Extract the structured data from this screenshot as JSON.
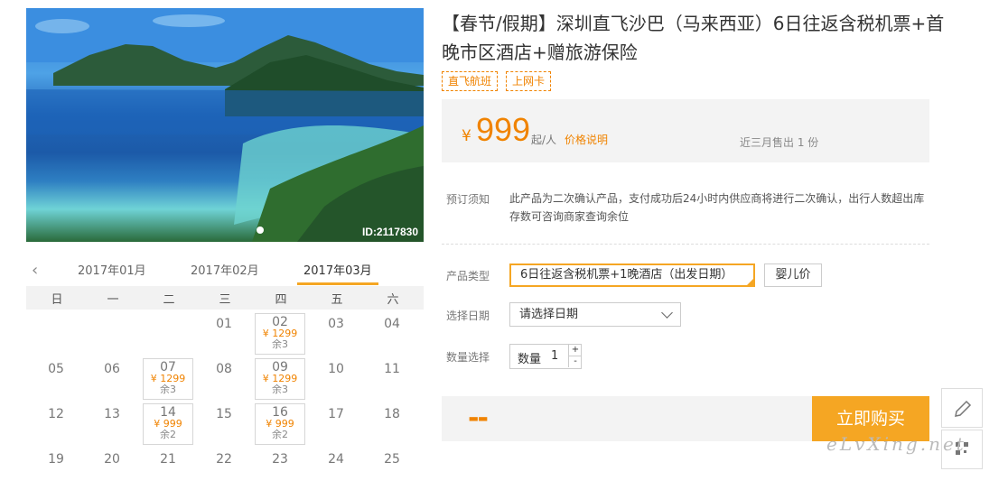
{
  "product": {
    "title": "【春节/假期】深圳直飞沙巴（马来西亚）6日往返含税机票+首晚市区酒店+赠旅游保险",
    "tags": [
      "直飞航班",
      "上网卡"
    ],
    "image_id": "ID:2117830"
  },
  "price": {
    "currency": "¥",
    "amount": "999",
    "per": "起/人",
    "explain_link": "价格说明",
    "sold": "近三月售出 1 份"
  },
  "booking": {
    "notice_label": "预订须知",
    "notice_text": "此产品为二次确认产品，支付成功后24小时内供应商将进行二次确认，出行人数超出库存数可咨询商家查询余位",
    "type_label": "产品类型",
    "type_value": "6日往返含税机票+1晚酒店（出发日期）",
    "infant_button": "婴儿价",
    "date_label": "选择日期",
    "date_placeholder": "请选择日期",
    "qty_label": "数量选择",
    "qty_field_label": "数量",
    "qty_value": "1",
    "plus": "+",
    "minus": "-",
    "total": "--",
    "buy_button": "立即购买"
  },
  "calendar": {
    "months": [
      "2017年01月",
      "2017年02月",
      "2017年03月"
    ],
    "active_month": "2017年03月",
    "weekdays": [
      "日",
      "一",
      "二",
      "三",
      "四",
      "五",
      "六"
    ],
    "days": [
      {
        "day": "01"
      },
      {
        "day": "02",
        "price": "¥ 1299",
        "remain": "余3"
      },
      {
        "day": "03"
      },
      {
        "day": "04"
      },
      {
        "day": "05"
      },
      {
        "day": "06"
      },
      {
        "day": "07",
        "price": "¥ 1299",
        "remain": "余3"
      },
      {
        "day": "08"
      },
      {
        "day": "09",
        "price": "¥ 1299",
        "remain": "余3"
      },
      {
        "day": "10"
      },
      {
        "day": "11"
      },
      {
        "day": "12"
      },
      {
        "day": "13"
      },
      {
        "day": "14",
        "price": "¥ 999",
        "remain": "余2"
      },
      {
        "day": "15"
      },
      {
        "day": "16",
        "price": "¥ 999",
        "remain": "余2"
      },
      {
        "day": "17"
      },
      {
        "day": "18"
      },
      {
        "day": "19"
      },
      {
        "day": "20"
      },
      {
        "day": "21"
      },
      {
        "day": "22"
      },
      {
        "day": "23"
      },
      {
        "day": "24"
      },
      {
        "day": "25"
      }
    ]
  },
  "watermark": "eLvXing.net",
  "colors": {
    "accent": "#f5a623",
    "price": "#f08300"
  }
}
